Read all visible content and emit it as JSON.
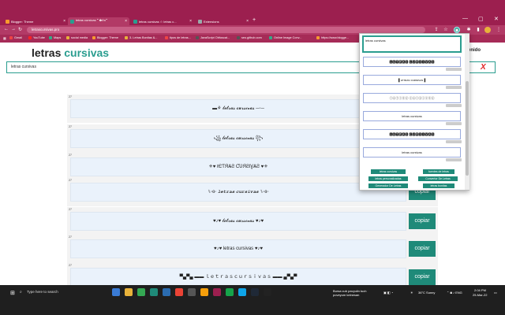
{
  "browser": {
    "tabs": [
      {
        "title": "Blogger: Theme",
        "color": "#f79a2e",
        "active": false
      },
      {
        "title": "letras cursivas 🙶 ✿ꫀꪀ🙶",
        "color": "#2a9d8f",
        "active": true
      },
      {
        "title": "letras cursivas ☆ letras c...",
        "color": "#2a9d8f",
        "active": false
      },
      {
        "title": "Extensions",
        "color": "#9aa",
        "active": false
      }
    ],
    "newtab_label": "+",
    "url": "letrascursivas.pro",
    "window_controls": [
      "—",
      "▢",
      "✕"
    ],
    "bookmarks": [
      {
        "label": "Gmail",
        "color": "#e44"
      },
      {
        "label": "YouTube",
        "color": "#f22"
      },
      {
        "label": "Maps",
        "color": "#3a8"
      },
      {
        "label": "social media",
        "color": "#e8b23a"
      },
      {
        "label": "Blogger: Theme",
        "color": "#f79a2e"
      },
      {
        "label": "3- Letras Bonitas &...",
        "color": "#e8b23a"
      },
      {
        "label": "tipos de letras...",
        "color": "#e44"
      },
      {
        "label": "JavaScript Obfuscat...",
        "color": "#555"
      },
      {
        "label": "seo.github.com",
        "color": "#555"
      },
      {
        "label": "Online Image Conv...",
        "color": "#3a8"
      },
      {
        "label": "https://www.blogge...",
        "color": "#f79a2e"
      }
    ]
  },
  "site": {
    "title_main": "letras",
    "title_accent": "cursivas",
    "menu_text": "enido",
    "search_value": "letras cursivas",
    "clear_label": "X",
    "copy_label": "copiar",
    "results": [
      {
        "num": "27",
        "text": "▬⚘ 𝓵𝓮𝓽𝓻𝓪𝓼 𝓬𝓾𝓻𝓼𝓲𝓿𝓪𝓼 ─◦─",
        "copy": false
      },
      {
        "num": "27",
        "text": "꧁ 𝓵𝓮𝓽𝓻𝓪𝓼 𝓬𝓾𝓻𝓼𝓲𝓿𝓪𝓼 ꧂",
        "copy": false
      },
      {
        "num": "27",
        "text": "⚜♥ ℓЄƬЯѦƧ ƇƲЯƧƖƔѦƧ ♥⚜",
        "copy": false
      },
      {
        "num": "27",
        "text": "⑊◦ɞ◦ 𝒍𝒆𝒕𝒓𝒂𝒔 𝒄𝒖𝒓𝒔𝒊𝒗𝒂𝒔 ⑊◦ɞ◦",
        "copy": true
      },
      {
        "num": "27",
        "text": "♥♪♥ 𝓵𝓮𝓽𝓻𝓪𝓼 𝓬𝓾𝓻𝓼𝓲𝓿𝓪𝓼 ♥♪♥",
        "copy": true
      },
      {
        "num": "27",
        "text": "♥♪♥ letras cursivas ♥♪♥",
        "copy": true
      },
      {
        "num": "27",
        "text": "▀▄▀▄ ▬▬ ｌｅｔｒａｓｃｕｒｓｉｖａｓ ▬▬ ▄▀▄▀",
        "copy": true
      }
    ]
  },
  "popup": {
    "input_value": "letras cursivas",
    "items": [
      "🅻🅴🆃🆁🅰🆂 🅲🆄🆁🆂🅸🆅🅰🆂",
      "▌ʟᴇᴛʀᴀs ᴄᴜʀsɪᴠᴀs▐",
      "ⓛⓔⓣⓡⓐⓢ ⓒⓤⓡⓢⓘⓥⓐⓢ",
      "letras cursivas",
      "🅻🅴🆃🆁🅰🆂 🅲🆄🆁🆂🅸🆅🅰🆂",
      "letras cursivas"
    ],
    "links": [
      "letras cursivas",
      "fuentes de letras",
      "letras personalizadas",
      "Convertor De Letras",
      "Generador De Letras",
      "letras bonitas"
    ]
  },
  "taskbar": {
    "search_placeholder": "Type here to search",
    "app_colors": [
      "#3a7bd5",
      "#e8b23a",
      "#34a853",
      "#1f8a79",
      "#2b6cb0",
      "#ea4335",
      "#555",
      "#f59e0b",
      "#9c1f4f",
      "#16a34a",
      "#0ea5e9",
      "#1f2937",
      "#222"
    ],
    "notification_line1": "Bursa cub pavyuiin tuch",
    "notification_line2": "poveyum kelnesan",
    "weather": "36°C  Sunny",
    "time": "2:04 PM",
    "date": "25-Mar-22"
  }
}
